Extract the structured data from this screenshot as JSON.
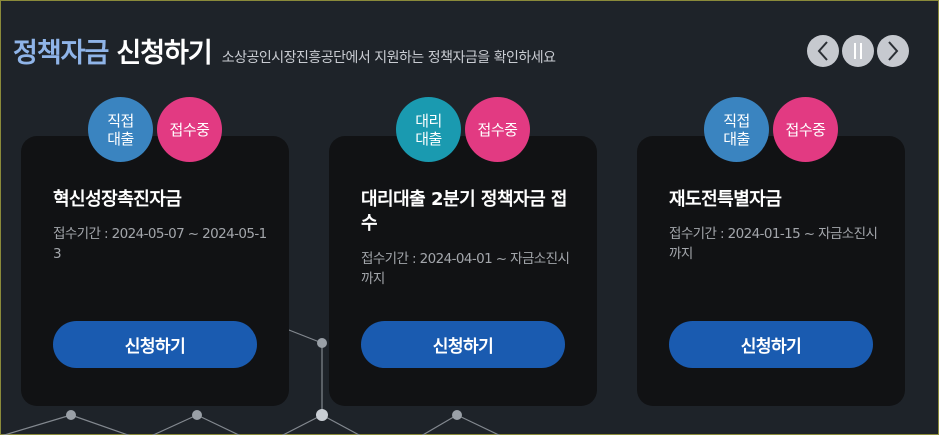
{
  "header": {
    "title_accent": "정책자금",
    "title_rest": "신청하기",
    "subtitle": "소상공인시장진흥공단에서 지원하는 정책자금을 확인하세요"
  },
  "controls": {
    "prev": "chevron-left-icon",
    "pause": "pause-icon",
    "next": "chevron-right-icon"
  },
  "cards": [
    {
      "type_badge": "직접\n대출",
      "status_badge": "접수중",
      "title": "혁신성장촉진자금",
      "period": "접수기간 : 2024-05-07 ~ 2024-05-13",
      "button": "신청하기"
    },
    {
      "type_badge": "대리\n대출",
      "status_badge": "접수중",
      "title": "대리대출 2분기 정책자금 접수",
      "period": "접수기간 : 2024-04-01 ~ 자금소진시까지",
      "button": "신청하기"
    },
    {
      "type_badge": "직접\n대출",
      "status_badge": "접수중",
      "title": "재도전특별자금",
      "period": "접수기간 : 2024-01-15 ~ 자금소진시까지",
      "button": "신청하기"
    }
  ],
  "colors": {
    "accent": "#8fb4e8",
    "button": "#1a5bb0",
    "badge_direct": "#3a84c0",
    "badge_agency": "#1a9ab0",
    "badge_status": "#e23a82"
  }
}
